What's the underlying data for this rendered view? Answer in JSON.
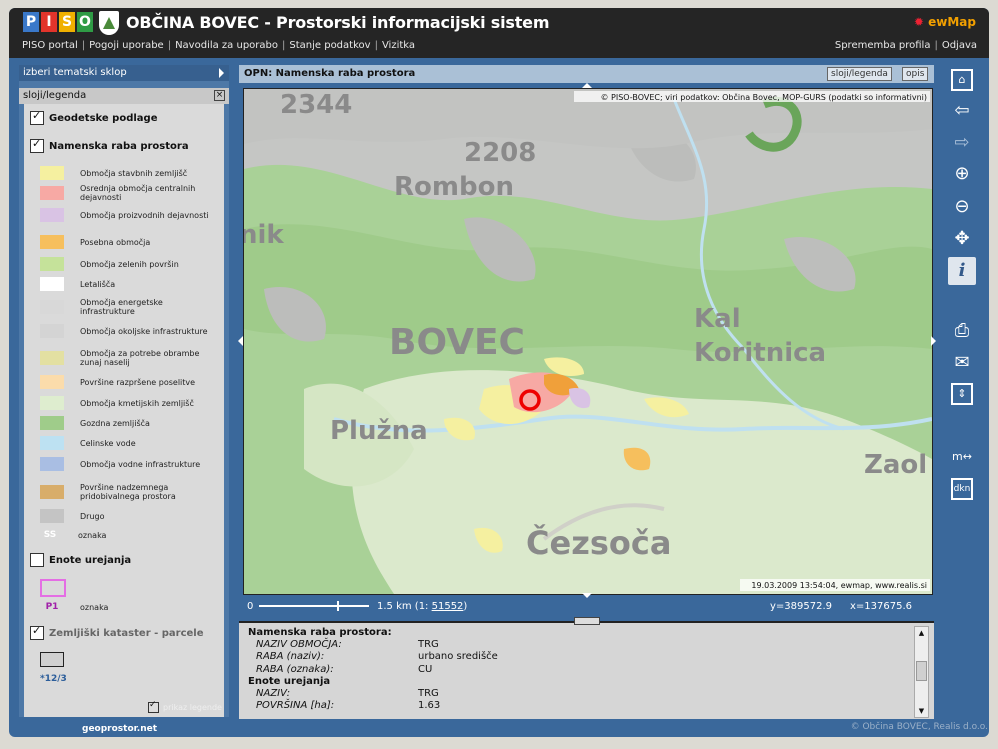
{
  "header": {
    "logo_letters": [
      "P",
      "I",
      "S",
      "O"
    ],
    "logo_colors": [
      "#3a78c9",
      "#e2342b",
      "#f0b000",
      "#2f9b45"
    ],
    "title": "OBČINA BOVEC - Prostorski informacijski sistem",
    "brand": "ewMap",
    "nav_left": [
      "PISO portal",
      "Pogoji uporabe",
      "Navodila za uporabo",
      "Stanje podatkov",
      "Vizitka"
    ],
    "nav_right": [
      "Sprememba profila",
      "Odjava"
    ]
  },
  "left": {
    "theme_selector": "izberi tematski sklop",
    "legend_title": "sloji/legenda",
    "layers": {
      "geodetske": "Geodetske podlage",
      "namenska": "Namenska raba prostora",
      "enote": "Enote urejanja",
      "kataster": "Zemljiški kataster - parcele"
    },
    "legend_items": [
      {
        "label": "Območja stavbnih zemljišč",
        "color": "#f5f0a0"
      },
      {
        "label": "Osrednja območja centralnih dejavnosti",
        "color": "#f7a9a4"
      },
      {
        "label": "Območja proizvodnih dejavnosti",
        "color": "#d9c3e4"
      },
      {
        "label": "Posebna območja",
        "color": "#f6bf5d"
      },
      {
        "label": "Območja zelenih površin",
        "color": "#c5e29a"
      },
      {
        "label": "Letališča",
        "color": "#ffffff"
      },
      {
        "label": "Območja energetske infrastrukture",
        "color": "#d8d8d8"
      },
      {
        "label": "Območja okoljske infrastrukture",
        "color": "#d4d4d4"
      },
      {
        "label": "Območja za potrebe obrambe zunaj naselij",
        "color": "#e3e0a2"
      },
      {
        "label": "Površine razpršene poselitve",
        "color": "#fbdcab"
      },
      {
        "label": "Območja kmetijskih zemljišč",
        "color": "#deedcf"
      },
      {
        "label": "Gozdna zemljišča",
        "color": "#9fcc8a"
      },
      {
        "label": "Celinske vode",
        "color": "#bde1f2"
      },
      {
        "label": "Območja vodne infrastrukture",
        "color": "#a9bee3"
      },
      {
        "label": "Površine nadzemnega pridobivalnega prostora",
        "color": "#d8ad6a"
      },
      {
        "label": "Drugo",
        "color": "#c4c4c4"
      }
    ],
    "ss_symbol": "SS",
    "ss_label": "oznaka",
    "p1_symbol": "P1",
    "p1_label": "oznaka",
    "parcel_label": "*12/3",
    "show_legend": "prikaz legende",
    "geoprostor": "geoprostor.net"
  },
  "map": {
    "title": "OPN: Namenska raba prostora",
    "btn_layers": "sloji/legenda",
    "btn_info": "opis",
    "attribution": "© PISO-BOVEC; viri podatkov: Občina Bovec, MOP-GURS (podatki so informativni)",
    "timestamp": "19.03.2009 13:54:04, ewmap, www.realis.si",
    "place_labels": [
      "2344",
      "2208",
      "Rombon",
      "nik",
      "BOVEC",
      "Kal",
      "Koritnica",
      "Plužna",
      "Zaol",
      "Čezsoča"
    ],
    "scale_zero": "0",
    "scale_text": "1.5 km (1: ",
    "scale_ratio": "51552",
    "scale_close": ")",
    "coords_y": "y=389572.9",
    "coords_x": "x=137675.6"
  },
  "results": [
    {
      "type": "head",
      "text": "Namenska raba prostora:"
    },
    {
      "type": "kv",
      "key": "NAZIV OBMOČJA:",
      "value": "TRG"
    },
    {
      "type": "kv",
      "key": "RABA (naziv):",
      "value": "urbano središče"
    },
    {
      "type": "kv",
      "key": "RABA (oznaka):",
      "value": "CU"
    },
    {
      "type": "head",
      "text": "Enote urejanja"
    },
    {
      "type": "kv",
      "key": "NAZIV:",
      "value": "TRG"
    },
    {
      "type": "kv",
      "key": "POVRŠINA [ha]:",
      "value": "1.63"
    }
  ],
  "tools": [
    "overview-icon",
    "back-arrow-icon",
    "forward-arrow-icon",
    "zoom-in-icon",
    "zoom-out-icon",
    "pan-icon",
    "info-icon",
    "print-icon",
    "mail-icon",
    "export-icon",
    "measure-icon",
    "dkn-icon"
  ],
  "tool_glyphs": {
    "info": "i",
    "measure": "m",
    "dkn": "dkn"
  },
  "footer": {
    "copyright": "© Občina BOVEC, Realis d.o.o."
  }
}
